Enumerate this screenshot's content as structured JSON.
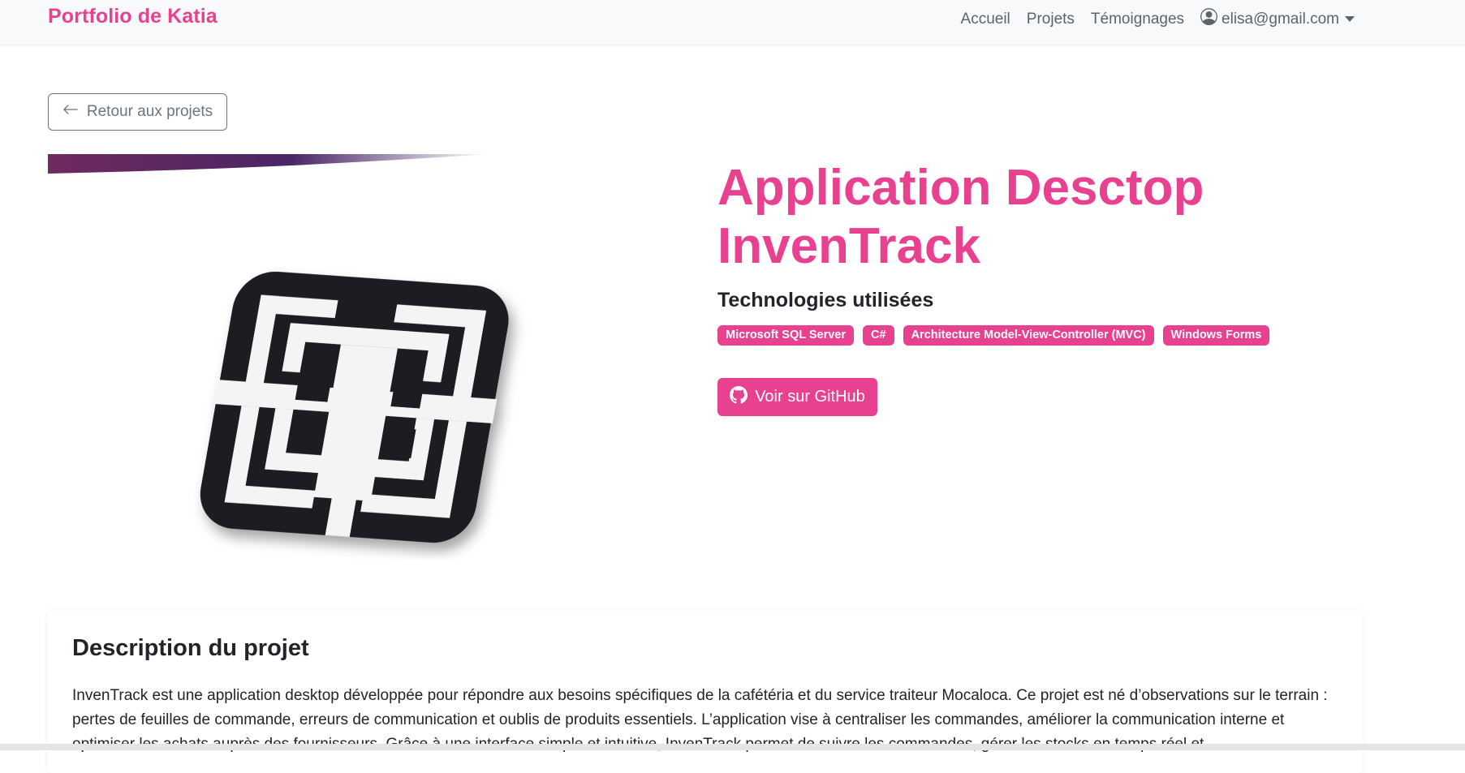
{
  "navbar": {
    "brand": "Portfolio de Katia",
    "links": [
      "Accueil",
      "Projets",
      "Témoignages"
    ],
    "user_email": "elisa@gmail.com"
  },
  "back_button": {
    "label": "Retour aux projets"
  },
  "project": {
    "title": "Application Desctop InvenTrack",
    "tech_heading": "Technologies utilisées",
    "technologies": [
      "Microsoft SQL Server",
      "C#",
      "Architecture Model-View-Controller (MVC)",
      "Windows Forms"
    ],
    "github_label": "Voir sur GitHub"
  },
  "description": {
    "title": "Description du projet",
    "text": "InvenTrack est une application desktop développée pour répondre aux besoins spécifiques de la cafétéria et du service traiteur Mocaloca. Ce projet est né d’observations sur le terrain : pertes de feuilles de commande, erreurs de communication et oublis de produits essentiels. L’application vise à centraliser les commandes, améliorer la communication interne et optimiser les achats auprès des fournisseurs. Grâce à une interface simple et intuitive, InvenTrack permet de suivre les commandes, gérer les stocks en temps réel et"
  },
  "colors": {
    "accent": "#e8418f",
    "navbar_bg": "#f8f9fa",
    "text": "#212529",
    "muted": "#6c757d"
  },
  "icons": {
    "user": "person-circle-icon",
    "dropdown": "caret-down-icon",
    "back": "arrow-left-icon",
    "github": "github-icon"
  }
}
